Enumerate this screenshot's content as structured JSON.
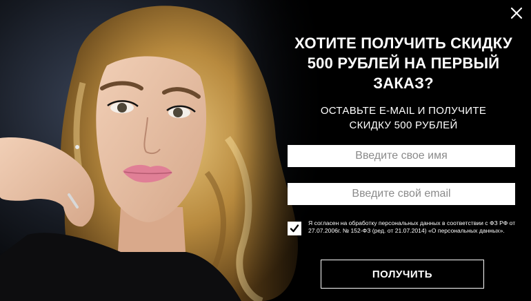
{
  "popup": {
    "close_icon": "close-icon",
    "title": "ХОТИТЕ ПОЛУЧИТЬ СКИДКУ\n500 РУБЛЕЙ НА ПЕРВЫЙ\nЗАКАЗ?",
    "subtitle": "ОСТАВЬТЕ E-MAIL И ПОЛУЧИТЕ\nСКИДКУ 500 РУБЛЕЙ",
    "name_field": {
      "value": "",
      "placeholder": "Введите свое имя"
    },
    "email_field": {
      "value": "",
      "placeholder": "Введите свой email"
    },
    "consent": {
      "checked": true,
      "check_icon": "checkmark-icon",
      "text": "Я согласен на обработку персональных данных в соответствии с ФЗ РФ от 27.07.2006г. № 152-ФЗ (ред. от 21.07.2014) «О персональных данных»."
    },
    "submit_label": "ПОЛУЧИТЬ"
  },
  "colors": {
    "background": "#000000",
    "text": "#ffffff",
    "input_background": "#ffffff",
    "placeholder": "#8a8a8a"
  }
}
